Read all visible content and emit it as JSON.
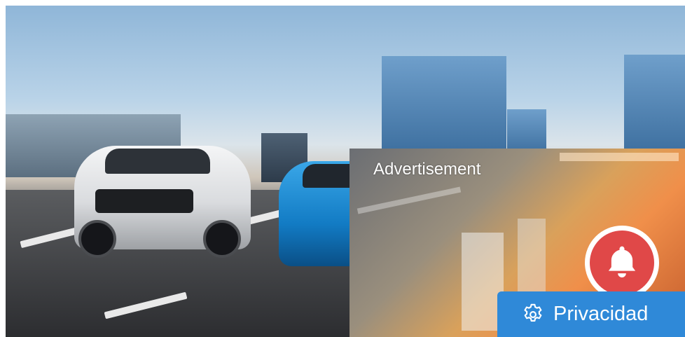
{
  "ad": {
    "label": "Advertisement"
  },
  "notification": {
    "icon": "bell-icon"
  },
  "privacy": {
    "icon": "gear-icon",
    "label": "Privacidad"
  },
  "colors": {
    "privacy_button": "#2f89d8",
    "bell_button": "#e04848"
  }
}
